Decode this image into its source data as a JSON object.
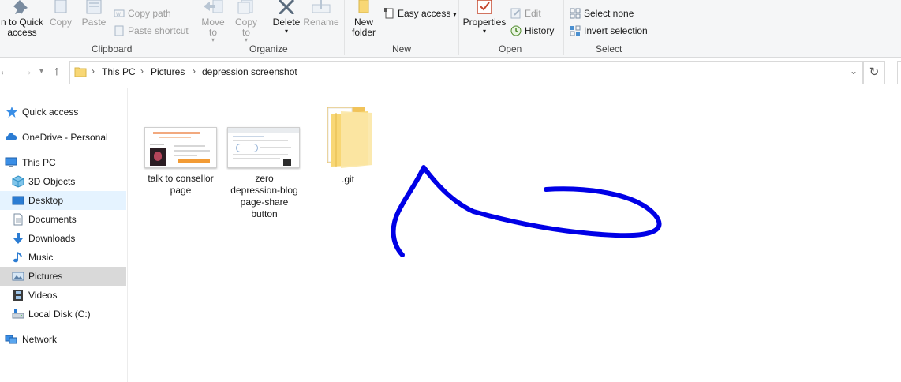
{
  "ribbon": {
    "clipboard": {
      "pin_label_line1": "n to Quick",
      "pin_label_line2": "access",
      "copy": "Copy",
      "paste": "Paste",
      "copy_path": "Copy path",
      "paste_shortcut": "Paste shortcut",
      "group_label": "Clipboard"
    },
    "organize": {
      "move_to_line1": "Move",
      "move_to_line2": "to",
      "copy_to_line1": "Copy",
      "copy_to_line2": "to",
      "delete": "Delete",
      "rename": "Rename",
      "group_label": "Organize"
    },
    "new": {
      "new_folder_line1": "New",
      "new_folder_line2": "folder",
      "easy_access": "Easy access",
      "group_label": "New"
    },
    "open": {
      "properties": "Properties",
      "edit": "Edit",
      "history": "History",
      "group_label": "Open"
    },
    "select": {
      "select_none": "Select none",
      "invert_selection": "Invert selection",
      "group_label": "Select"
    }
  },
  "address": {
    "crumbs": [
      "This PC",
      "Pictures",
      "depression screenshot"
    ]
  },
  "nav_pane": {
    "items": [
      {
        "label": "Quick access",
        "icon": "star-icon"
      },
      {
        "label": "OneDrive - Personal",
        "icon": "cloud-icon"
      },
      {
        "label": "This PC",
        "icon": "computer-icon"
      },
      {
        "label": "3D Objects",
        "icon": "cube-icon"
      },
      {
        "label": "Desktop",
        "icon": "desktop-icon"
      },
      {
        "label": "Documents",
        "icon": "document-icon"
      },
      {
        "label": "Downloads",
        "icon": "download-icon"
      },
      {
        "label": "Music",
        "icon": "music-icon"
      },
      {
        "label": "Pictures",
        "icon": "pictures-icon"
      },
      {
        "label": "Videos",
        "icon": "video-icon"
      },
      {
        "label": "Local Disk (C:)",
        "icon": "drive-icon"
      },
      {
        "label": "Network",
        "icon": "network-icon"
      }
    ]
  },
  "files": [
    {
      "name_lines": [
        "talk to consellor",
        "page"
      ],
      "type": "image"
    },
    {
      "name_lines": [
        "zero",
        "depression-blog",
        "page-share",
        "button"
      ],
      "type": "image"
    },
    {
      "name_lines": [
        ".git"
      ],
      "type": "folder"
    }
  ],
  "colors": {
    "annotation_stroke": "#0000e6",
    "selected_nav": "#d9d9d9",
    "hover_nav": "#e5f3ff",
    "ribbon_bg": "#f5f6f7",
    "folder_yellow": "#f8d775"
  }
}
